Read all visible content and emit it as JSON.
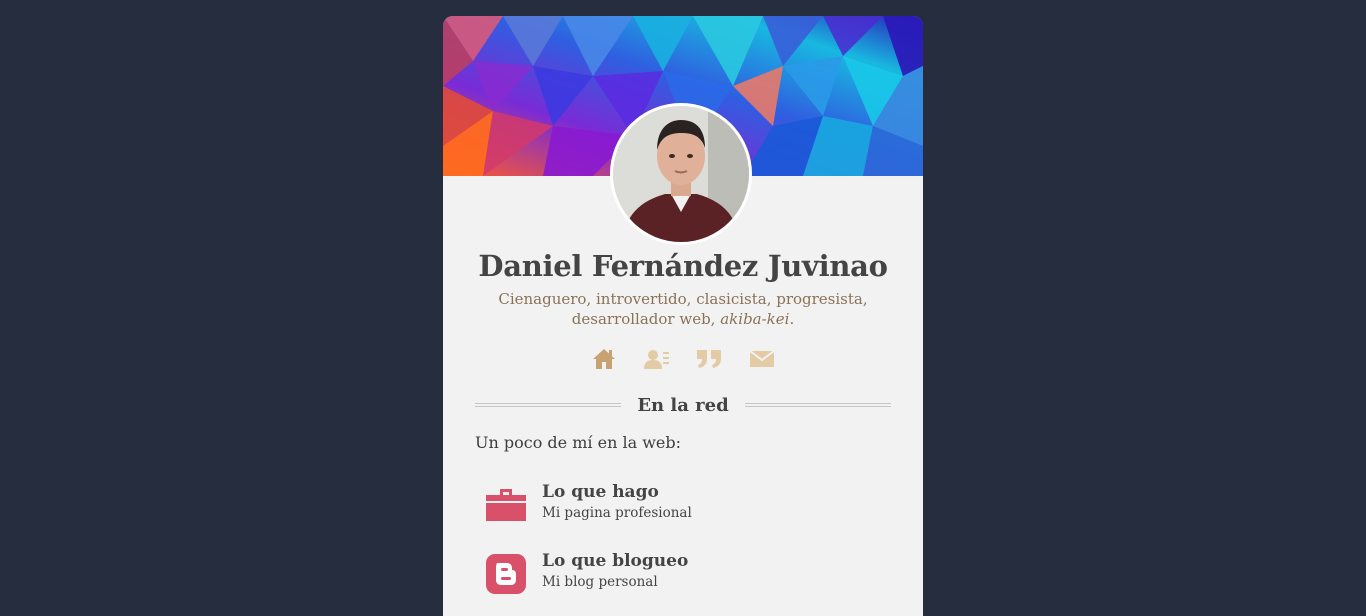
{
  "profile": {
    "name": "Daniel Fernández Juvinao",
    "bio_main": "Cienaguero, introvertido, clasicista, progresista, desarrollador web, ",
    "bio_em": "akiba-kei",
    "bio_end": "."
  },
  "social_icons": [
    "home-icon",
    "contact-card-icon",
    "quote-icon",
    "mail-icon"
  ],
  "section": {
    "title": "En la red",
    "intro": "Un poco de mí en la web:"
  },
  "links": [
    {
      "title": "Lo que hago",
      "subtitle": "Mi pagina profesional",
      "icon": "briefcase-icon"
    },
    {
      "title": "Lo que blogueo",
      "subtitle": "Mi blog personal",
      "icon": "blogger-icon"
    }
  ],
  "colors": {
    "background": "#252d3e",
    "card": "#f2f2f2",
    "accent_icon": "#d6b98a",
    "link_icon": "#d9506a",
    "bio_text": "#8a7258",
    "heading_text": "#444444"
  }
}
